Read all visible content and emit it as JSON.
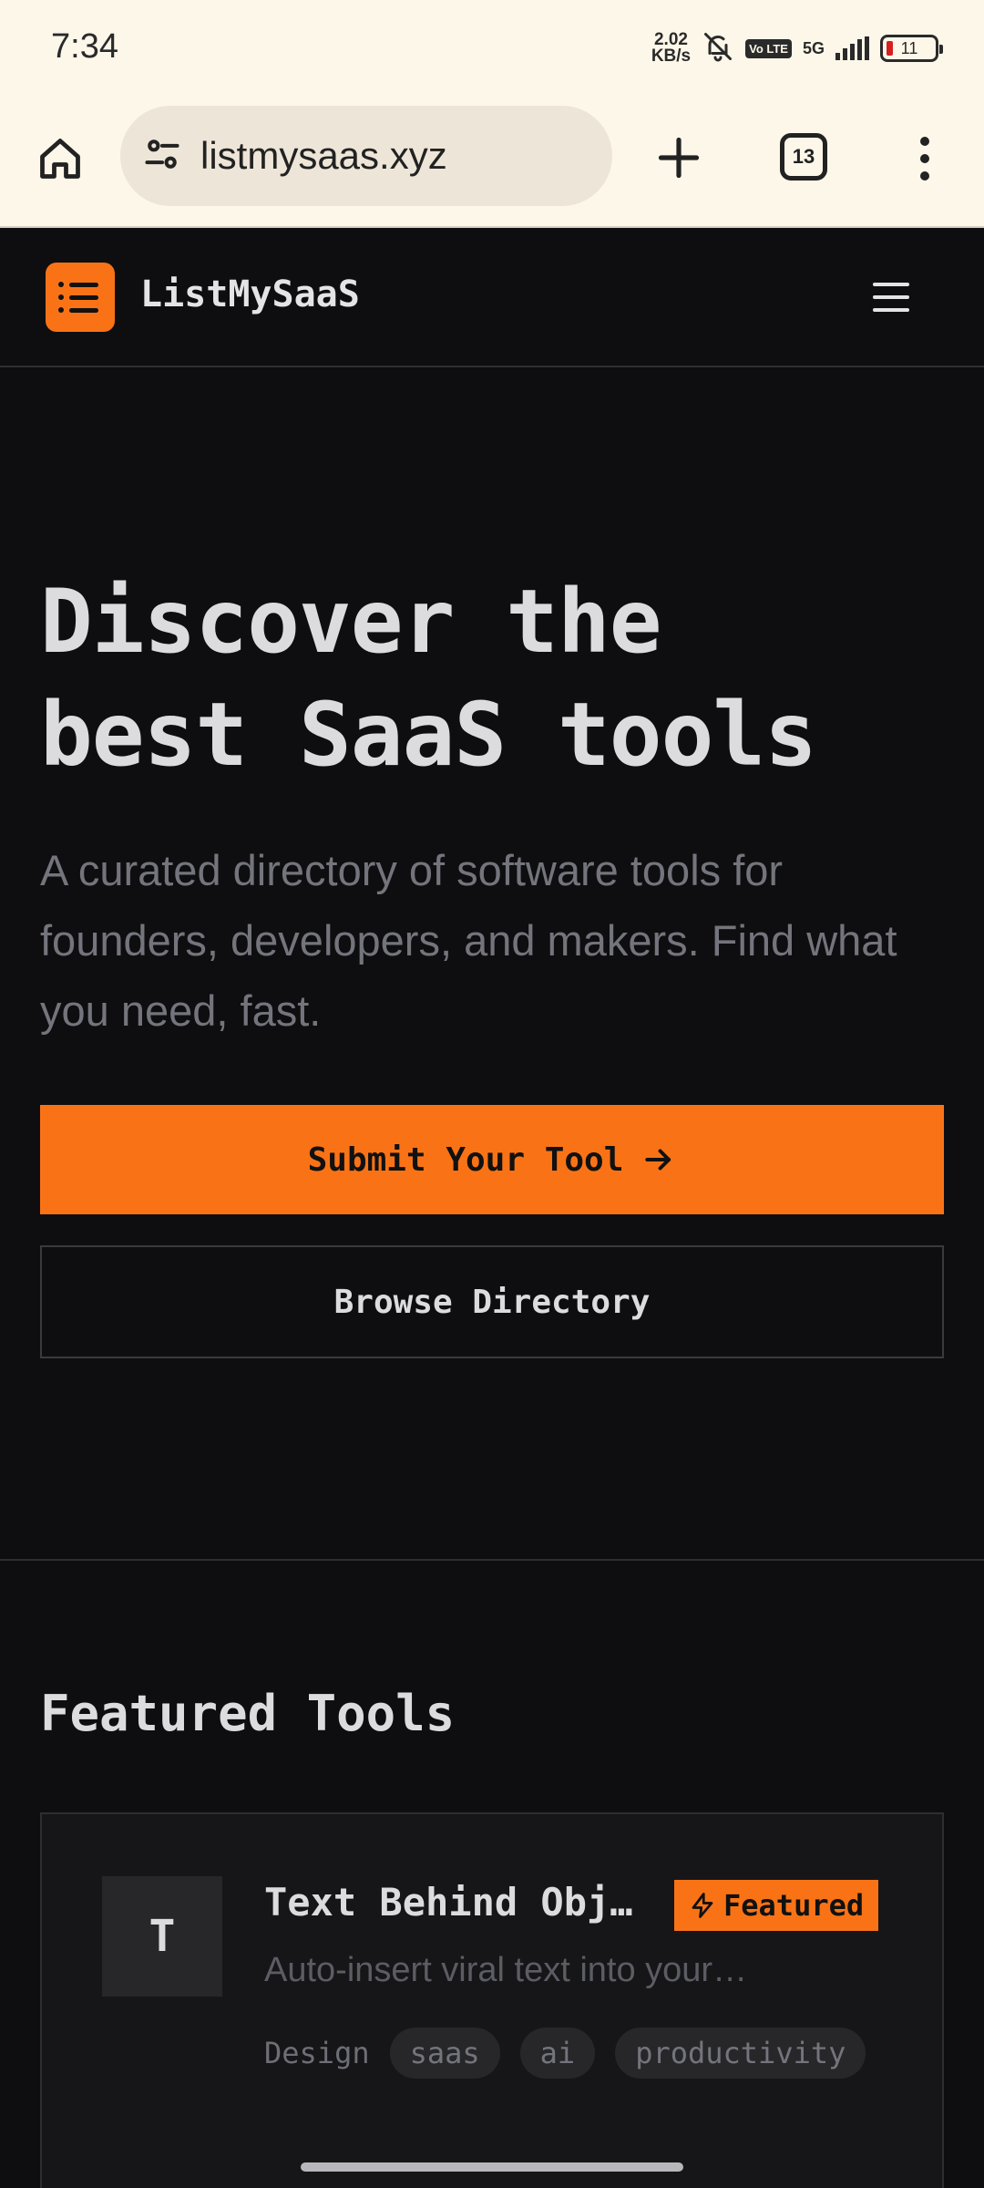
{
  "status_bar": {
    "time": "7:34",
    "net_speed_value": "2.02",
    "net_speed_unit": "KB/s",
    "volte_label": "Vo LTE",
    "network_label": "5G",
    "battery_level": "11"
  },
  "browser": {
    "url": "listmysaas.xyz",
    "tab_count": "13"
  },
  "site": {
    "brand": "ListMySaaS",
    "accent_color": "#f97316"
  },
  "hero": {
    "title_line1": "Discover the",
    "title_line2": "best SaaS tools",
    "subtitle": "A curated directory of software tools for founders, developers, and makers. Find what you need, fast.",
    "primary_button": "Submit Your Tool",
    "primary_button_icon": "arrow-right-icon",
    "secondary_button": "Browse Directory"
  },
  "featured": {
    "section_title": "Featured Tools",
    "tools": [
      {
        "avatar_letter": "T",
        "name": "Text Behind Obj…",
        "badge": "Featured",
        "badge_icon": "lightning-icon",
        "description": "Auto-insert viral text into your…",
        "category": "Design",
        "tags": [
          "saas",
          "ai",
          "productivity"
        ]
      }
    ]
  }
}
